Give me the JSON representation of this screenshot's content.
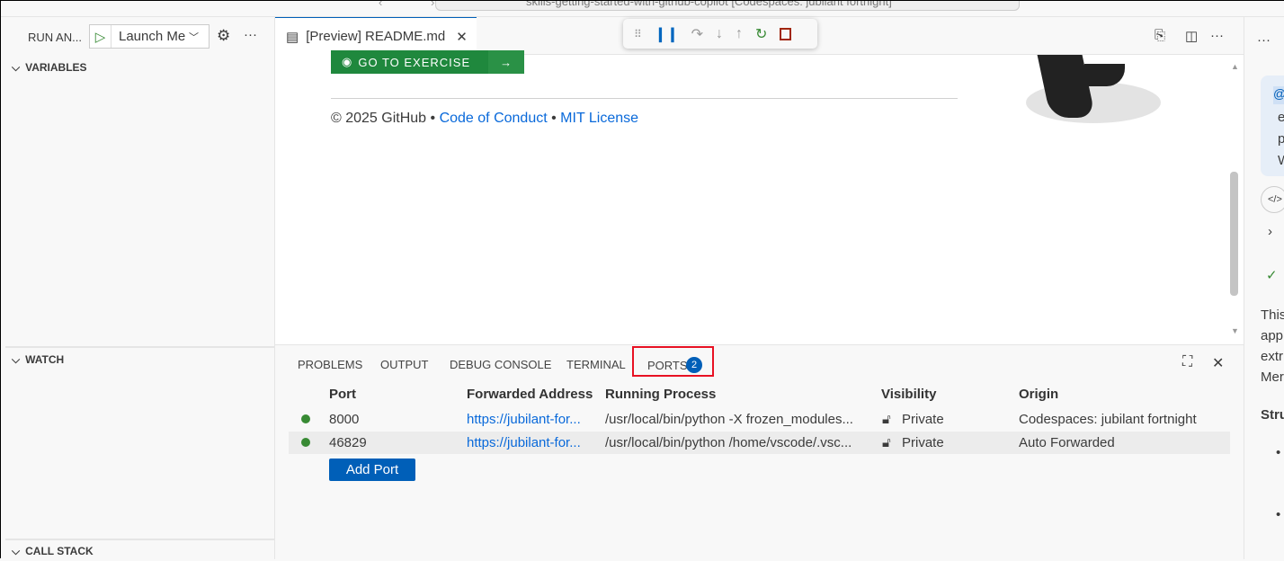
{
  "titlebar": {
    "title": "skills-getting-started-with-github-copilot [Codespaces: jubilant fortnight]"
  },
  "sidebar": {
    "run_label": "RUN AN...",
    "launch_config": "Launch Me",
    "variables": "VARIABLES",
    "watch": "WATCH",
    "call_stack": "CALL STACK"
  },
  "editor": {
    "tab_label": "[Preview] README.md",
    "go_button": "GO TO EXERCISE",
    "go_arrow": "→",
    "footer": {
      "copyright": "© 2025 GitHub •",
      "code_of_conduct": "Code of Conduct",
      "sep": "•",
      "license": "MIT License"
    }
  },
  "panel": {
    "tabs": [
      "PROBLEMS",
      "OUTPUT",
      "DEBUG CONSOLE",
      "TERMINAL",
      "PORTS"
    ],
    "ports_badge": "2",
    "columns": [
      "Port",
      "Forwarded Address",
      "Running Process",
      "Visibility",
      "Origin"
    ],
    "rows": [
      {
        "port": "8000",
        "address": "https://jubilant-for...",
        "process": "/usr/local/bin/python -X frozen_modules...",
        "visibility": "Private",
        "origin": "Codespaces: jubilant fortnight"
      },
      {
        "port": "46829",
        "address": "https://jubilant-for...",
        "process": "/usr/local/bin/python /home/vscode/.vsc...",
        "visibility": "Private",
        "origin": "Auto Forwarded"
      }
    ],
    "add_port": "Add Port"
  },
  "right_pane": {
    "lines": [
      "ex",
      "pı",
      "W",
      "This",
      "app",
      "extr",
      "Mer",
      "Stru"
    ]
  },
  "colors": {
    "accent": "#005fb8",
    "status_green": "#388a34",
    "highlight": "#e81123"
  }
}
